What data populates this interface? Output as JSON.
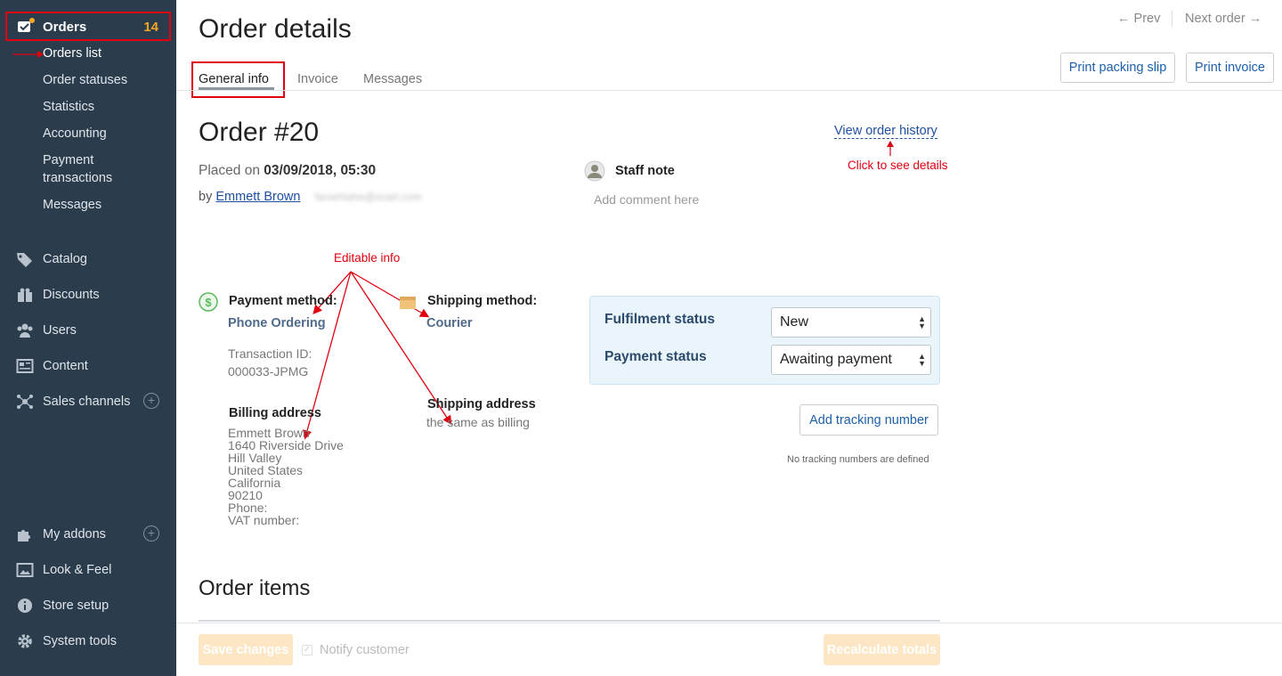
{
  "sidebar": {
    "orders_label": "Orders",
    "orders_count": "14",
    "sub_items": [
      {
        "label": "Orders list"
      },
      {
        "label": "Order statuses"
      },
      {
        "label": "Statistics"
      },
      {
        "label": "Accounting"
      },
      {
        "label": "Payment"
      },
      {
        "label": "transactions"
      },
      {
        "label": "Messages"
      }
    ],
    "nav": [
      {
        "label": "Catalog",
        "icon": "tag-icon"
      },
      {
        "label": "Discounts",
        "icon": "gift-icon"
      },
      {
        "label": "Users",
        "icon": "users-icon"
      },
      {
        "label": "Content",
        "icon": "newspaper-icon"
      },
      {
        "label": "Sales channels",
        "icon": "network-icon"
      },
      {
        "label": "My addons",
        "icon": "puzzle-icon"
      },
      {
        "label": "Look & Feel",
        "icon": "image-icon"
      },
      {
        "label": "Store setup",
        "icon": "info-icon"
      },
      {
        "label": "System tools",
        "icon": "gear-icon"
      }
    ],
    "add_symbol": "+"
  },
  "header": {
    "title": "Order details",
    "prev": "← Prev",
    "next": "Next order →",
    "tabs": [
      "General info",
      "Invoice",
      "Messages"
    ],
    "print_packing_slip": "Print packing slip",
    "print_invoice": "Print invoice"
  },
  "order": {
    "title": "Order #20",
    "placed_prefix": "Placed on",
    "placed_date": "03/09/2018, 05:30",
    "by_prefix": "by",
    "customer": "Emmett Brown",
    "email_blurred": "farsehlahe@xcart.com",
    "view_history": "View order history",
    "staff_note_label": "Staff note",
    "staff_note_placeholder": "Add comment here",
    "payment_method_label": "Payment method:",
    "payment_method": "Phone Ordering",
    "transaction_label": "Transaction ID:",
    "transaction_id": "000033-JPMG",
    "shipping_method_label": "Shipping method:",
    "shipping_method": "Courier",
    "billing_label": "Billing address",
    "billing_lines": [
      "Emmett Brown",
      "1640 Riverside Drive",
      "Hill Valley",
      "United States",
      "California",
      "90210",
      "Phone:",
      "VAT number:"
    ],
    "shipping_label": "Shipping address",
    "shipping_same": "the same as billing",
    "fulfilment_label": "Fulfilment status",
    "fulfilment_value": "New",
    "payment_status_label": "Payment status",
    "payment_status_value": "Awaiting payment",
    "add_tracking": "Add tracking number",
    "no_tracking": "No tracking numbers are defined",
    "items_title": "Order items"
  },
  "annotations": {
    "click_details": "Click to see details",
    "editable": "Editable info"
  },
  "footer": {
    "save": "Save changes",
    "notify": "Notify customer",
    "recalculate": "Recalculate totals"
  },
  "colors": {
    "sidebar": "#2b3c4c",
    "accent": "#f5a623",
    "annotation": "#e0000f",
    "link": "#1e4fa0"
  }
}
